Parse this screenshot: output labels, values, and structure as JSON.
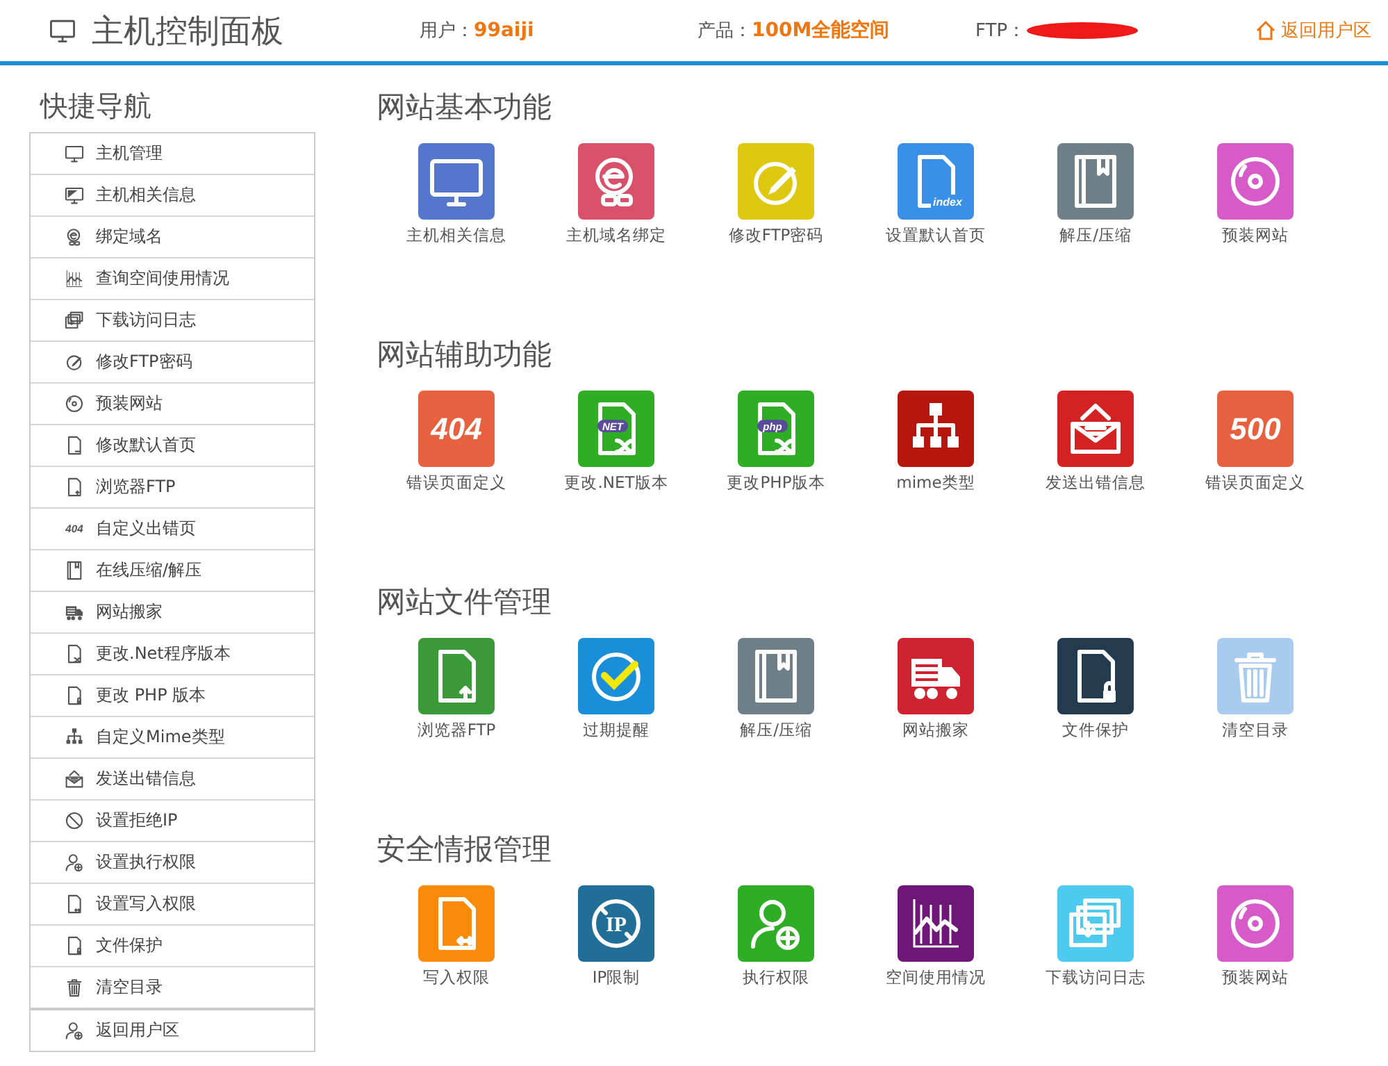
{
  "header": {
    "title": "主机控制面板",
    "fields": [
      {
        "label": "用户：",
        "value": "99aiji",
        "redacted": false
      },
      {
        "label": "产品：",
        "value": "100M全能空间",
        "redacted": false
      },
      {
        "label": "FTP：",
        "redacted": true
      }
    ],
    "back_link": "返回用户区"
  },
  "sidebar": {
    "title": "快捷导航",
    "items": [
      {
        "label": "主机管理",
        "kind": "monitor"
      },
      {
        "label": "主机相关信息",
        "kind": "monitor2"
      },
      {
        "label": "绑定域名",
        "kind": "elink"
      },
      {
        "label": "查询空间使用情况",
        "kind": "chart"
      },
      {
        "label": "下载访问日志",
        "kind": "stack"
      },
      {
        "label": "修改FTP密码",
        "kind": "pencil"
      },
      {
        "label": "预装网站",
        "kind": "disc"
      },
      {
        "label": "修改默认首页",
        "kind": "doc"
      },
      {
        "label": "浏览器FTP",
        "kind": "docup"
      },
      {
        "label": "自定义出错页",
        "kind": "text",
        "badge": "404"
      },
      {
        "label": "在线压缩/解压",
        "kind": "book"
      },
      {
        "label": "网站搬家",
        "kind": "truck"
      },
      {
        "label": "更改.Net程序版本",
        "kind": "docshuffle"
      },
      {
        "label": "更改 PHP 版本",
        "kind": "doclock"
      },
      {
        "label": "自定义Mime类型",
        "kind": "tree"
      },
      {
        "label": "发送出错信息",
        "kind": "mail"
      },
      {
        "label": "设置拒绝IP",
        "kind": "noip"
      },
      {
        "label": "设置执行权限",
        "kind": "useradd"
      },
      {
        "label": "设置写入权限",
        "kind": "docarrows"
      },
      {
        "label": "文件保护",
        "kind": "doclock"
      },
      {
        "label": "清空目录",
        "kind": "trash"
      },
      {
        "label": "返回用户区",
        "kind": "useradd"
      }
    ]
  },
  "sections": [
    {
      "title": "网站基本功能",
      "tiles": [
        {
          "label": "主机相关信息",
          "kind": "monitor",
          "color": "#5477cc"
        },
        {
          "label": "主机域名绑定",
          "kind": "elink",
          "color": "#d9506a"
        },
        {
          "label": "修改FTP密码",
          "kind": "pencil",
          "color": "#dfc812"
        },
        {
          "label": "设置默认首页",
          "kind": "doc",
          "color": "#3a8fe6",
          "badge": "index"
        },
        {
          "label": "解压/压缩",
          "kind": "book",
          "color": "#6e7f88"
        },
        {
          "label": "预装网站",
          "kind": "disc",
          "color": "#d65bc8"
        }
      ]
    },
    {
      "title": "网站辅助功能",
      "tiles": [
        {
          "label": "错误页面定义",
          "kind": "text",
          "color": "#e8613e",
          "badge": "404"
        },
        {
          "label": "更改.NET版本",
          "kind": "docshuffle",
          "color": "#2fae25",
          "badge": "NET"
        },
        {
          "label": "更改PHP版本",
          "kind": "docshuffle",
          "color": "#2fae25",
          "badge": "php"
        },
        {
          "label": "mime类型",
          "kind": "tree",
          "color": "#b5170e"
        },
        {
          "label": "发送出错信息",
          "kind": "mail",
          "color": "#d42121"
        },
        {
          "label": "错误页面定义",
          "kind": "text",
          "color": "#e8613e",
          "badge": "500"
        }
      ]
    },
    {
      "title": "网站文件管理",
      "tiles": [
        {
          "label": "浏览器FTP",
          "kind": "docup",
          "color": "#3a9a3a"
        },
        {
          "label": "过期提醒",
          "kind": "clock",
          "color": "#1a8ed8"
        },
        {
          "label": "解压/压缩",
          "kind": "book",
          "color": "#6e7f88"
        },
        {
          "label": "网站搬家",
          "kind": "truck",
          "color": "#cf2230"
        },
        {
          "label": "文件保护",
          "kind": "doclock",
          "color": "#243a4e"
        },
        {
          "label": "清空目录",
          "kind": "trash",
          "color": "#a9cbef"
        }
      ]
    },
    {
      "title": "安全情报管理",
      "tiles": [
        {
          "label": "写入权限",
          "kind": "docarrows",
          "color": "#f98a0a"
        },
        {
          "label": "IP限制",
          "kind": "noip",
          "color": "#216e98",
          "badge": "IP"
        },
        {
          "label": "执行权限",
          "kind": "useradd",
          "color": "#2fae25"
        },
        {
          "label": "空间使用情况",
          "kind": "chart",
          "color": "#6e1779"
        },
        {
          "label": "下载访问日志",
          "kind": "stack",
          "color": "#4ccaf0"
        },
        {
          "label": "预装网站",
          "kind": "disc",
          "color": "#d65bc8"
        }
      ]
    }
  ]
}
